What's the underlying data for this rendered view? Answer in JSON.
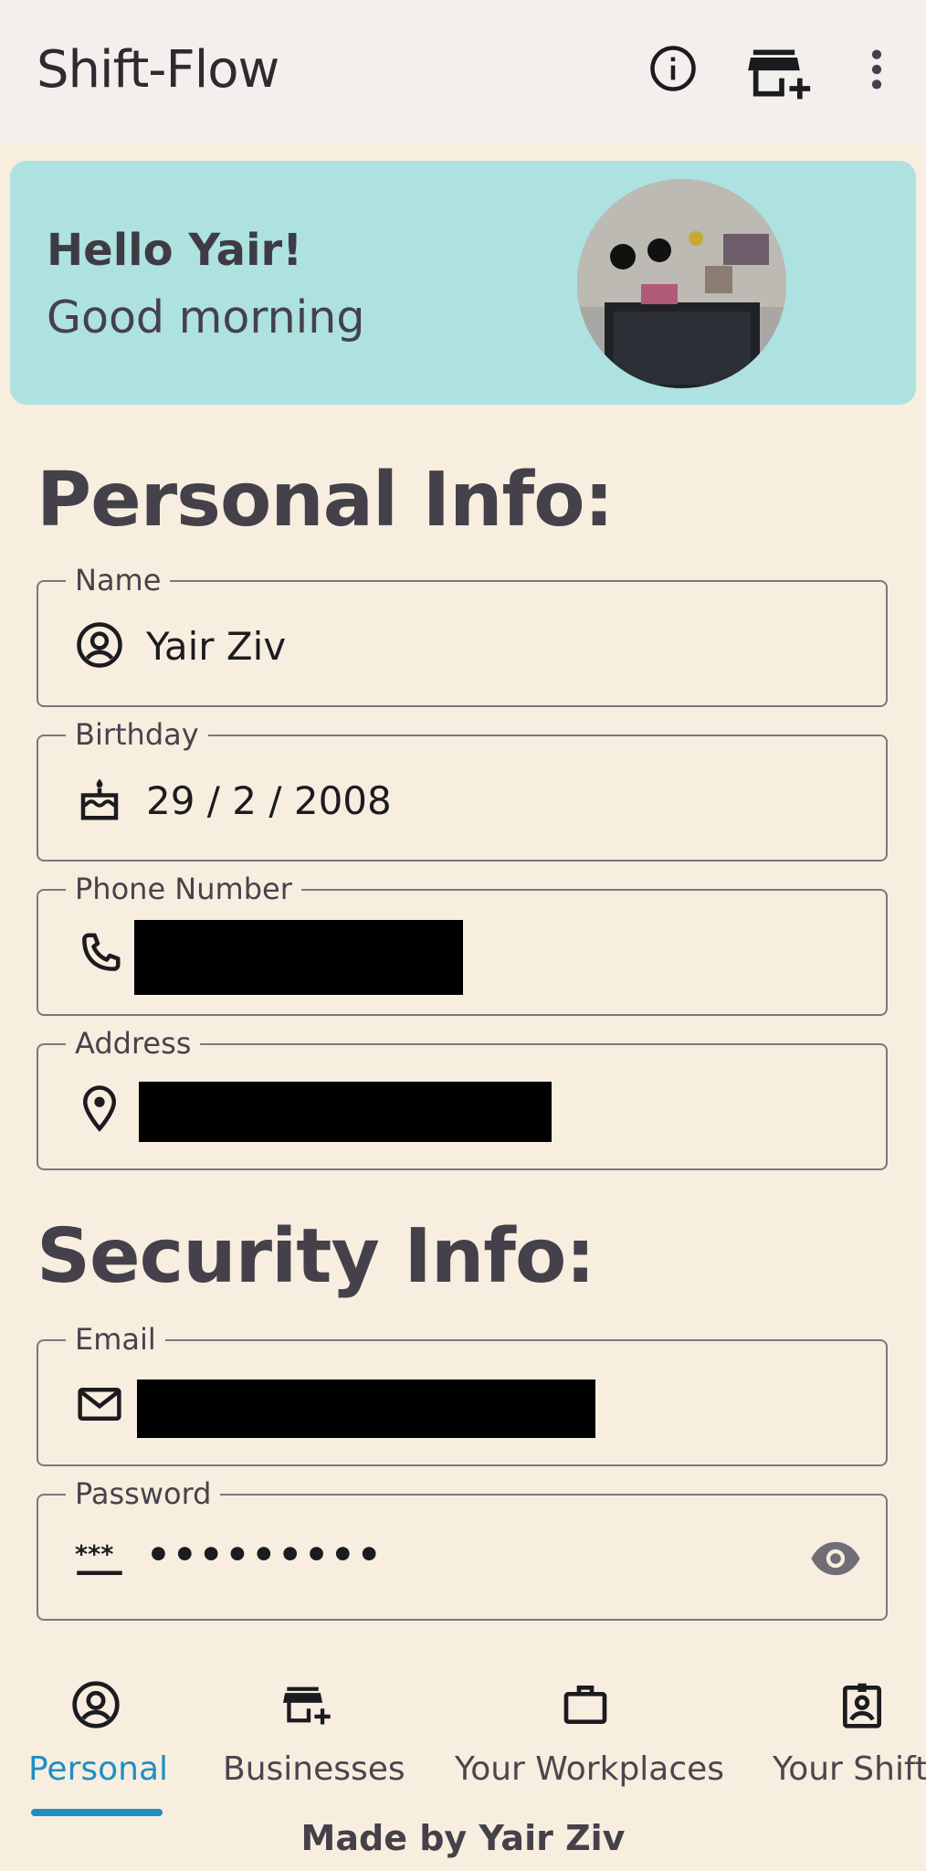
{
  "app": {
    "title": "Shift-Flow"
  },
  "appbar": {
    "icons": [
      "info-icon",
      "add-business-icon",
      "more-vert-icon"
    ]
  },
  "greeting": {
    "hello": "Hello Yair!",
    "sub": "Good morning"
  },
  "personal": {
    "title": "Personal Info:",
    "name": {
      "label": "Name",
      "value": "Yair Ziv",
      "icon": "account-circle-icon"
    },
    "birthday": {
      "label": "Birthday",
      "value": "29 / 2 / 2008",
      "icon": "cake-icon"
    },
    "phone": {
      "label": "Phone Number",
      "icon": "phone-icon"
    },
    "address": {
      "label": "Address",
      "icon": "location-pin-icon"
    }
  },
  "security": {
    "title": "Security Info:",
    "email": {
      "label": "Email",
      "icon": "mail-icon"
    },
    "password": {
      "label": "Password",
      "value": "•••••••••",
      "icon": "password-icon"
    }
  },
  "nav": {
    "items": [
      {
        "label": "Personal",
        "icon": "account-circle-icon",
        "active": true
      },
      {
        "label": "Businesses",
        "icon": "add-business-icon"
      },
      {
        "label": "Your Workplaces",
        "icon": "work-icon"
      },
      {
        "label": "Your Shift",
        "icon": "badge-icon"
      }
    ]
  },
  "footer": {
    "text": "Made by Yair Ziv"
  },
  "colors": {
    "background": "#f7eedf",
    "greeting_card": "#ade2e0",
    "accent": "#1e8fc4",
    "appbar": "#f3efec"
  }
}
